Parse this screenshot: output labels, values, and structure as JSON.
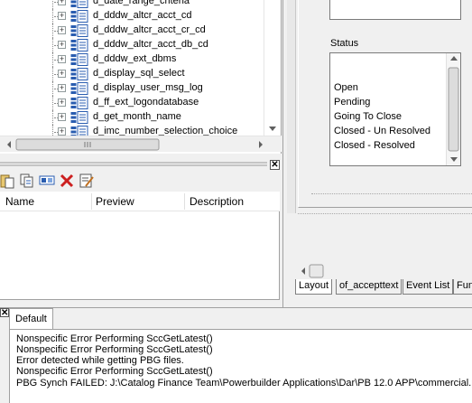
{
  "tree": {
    "items": [
      {
        "label": "d_date_range_criteria"
      },
      {
        "label": "d_dddw_altcr_acct_cd"
      },
      {
        "label": "d_dddw_altcr_acct_cr_cd"
      },
      {
        "label": "d_dddw_altcr_acct_db_cd"
      },
      {
        "label": "d_dddw_ext_dbms"
      },
      {
        "label": "d_display_sql_select"
      },
      {
        "label": "d_display_user_msg_log"
      },
      {
        "label": "d_ff_ext_logondatabase"
      },
      {
        "label": "d_get_month_name"
      },
      {
        "label": "d_imc_number_selection_choice"
      }
    ],
    "expand_glyph": "+"
  },
  "library_list": {
    "columns": [
      "Name",
      "Preview",
      "Description"
    ]
  },
  "properties": {
    "status_label": "Status",
    "status_options": [
      "Open",
      "Pending",
      "Going To Close",
      "Closed - Un Resolved",
      "Closed - Resolved"
    ],
    "tabs": [
      "Layout",
      "of_accepttext",
      "Event List",
      "Fun"
    ]
  },
  "output": {
    "tab_label": "Default",
    "lines": [
      "Nonspecific Error Performing SccGetLatest()",
      "Nonspecific Error Performing SccGetLatest()",
      "Error detected while getting PBG files.",
      "Nonspecific Error Performing SccGetLatest()",
      "PBG Synch FAILED: J:\\Catalog Finance Team\\Powerbuilder Applications\\Dar\\PB 12.0 APP\\commercial.pbg"
    ]
  },
  "colors": {
    "datawindow_icon_blue": "#2a5db0",
    "delete_red": "#cc1f1f",
    "window_bg": "#f0f0f0"
  }
}
